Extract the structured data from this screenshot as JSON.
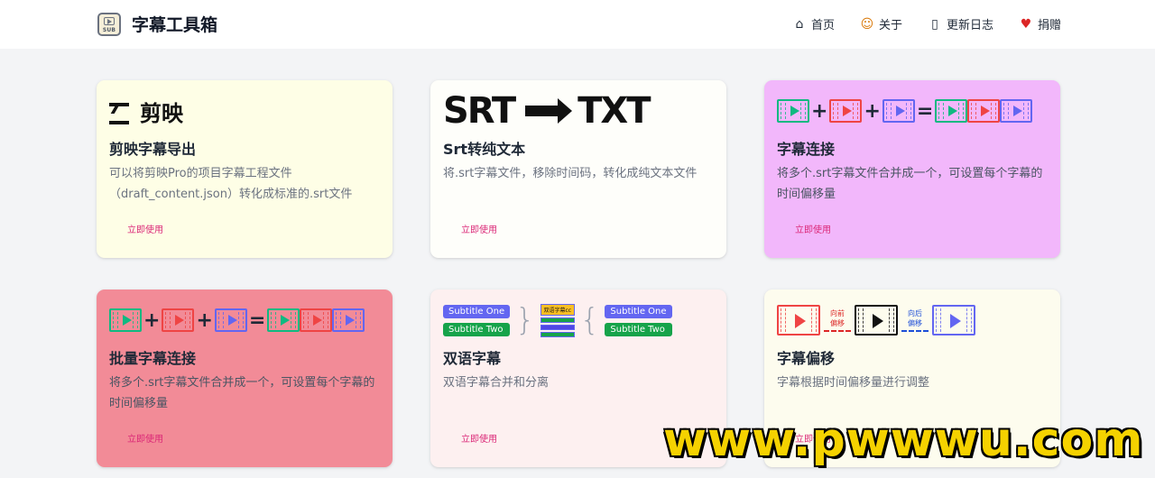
{
  "header": {
    "logo_text": "SUB",
    "brand": "字幕工具箱",
    "nav": [
      {
        "label": "首页",
        "icon": "home-icon"
      },
      {
        "label": "关于",
        "icon": "smiley-icon"
      },
      {
        "label": "更新日志",
        "icon": "log-icon"
      },
      {
        "label": "捐赠",
        "icon": "heart-icon"
      }
    ]
  },
  "cards": [
    {
      "art_text": "剪映",
      "title": "剪映字幕导出",
      "desc": "可以将剪映Pro的项目字幕工程文件（draft_content.json）转化成标准的.srt文件",
      "button": "立即使用"
    },
    {
      "art_left": "SRT",
      "art_right": "TXT",
      "title": "Srt转纯文本",
      "desc": "将.srt字幕文件，移除时间码，转化成纯文本文件",
      "button": "立即使用"
    },
    {
      "title": "字幕连接",
      "desc": "将多个.srt字幕文件合并成一个，可设置每个字幕的时间偏移量",
      "button": "立即使用"
    },
    {
      "title": "批量字幕连接",
      "desc": "将多个.srt字幕文件合并成一个，可设置每个字幕的时间偏移量",
      "button": "立即使用"
    },
    {
      "pill_one": "Subtitle One",
      "pill_two": "Subtitle Two",
      "stack_label": "双语字幕cc",
      "title": "双语字幕",
      "desc": "双语字幕合并和分离",
      "button": "立即使用"
    },
    {
      "shift_back": "向前\n偏移",
      "shift_fwd": "向后\n偏移",
      "title": "字幕偏移",
      "desc": "字幕根据时间偏移量进行调整",
      "button": "立即使用"
    }
  ],
  "watermark": "www.pwwwu.com",
  "colors": {
    "accent": "#db2777",
    "green": "#10b981",
    "red": "#ef4444",
    "blue": "#6366f1"
  }
}
